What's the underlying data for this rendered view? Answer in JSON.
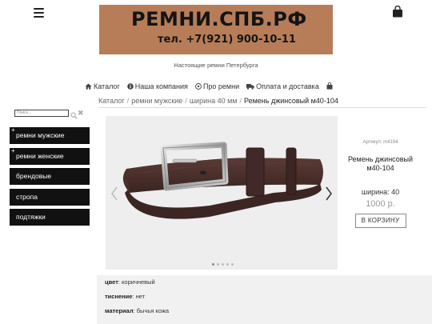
{
  "header": {
    "logo_title": "РЕМНИ.СПБ.РФ",
    "logo_phone": "тел. +7(921) 900-10-11",
    "tagline": "Настоящие ремни Петербурга",
    "icons": {
      "menu": "hamburger-menu-icon",
      "cart": "shopping-bag-icon"
    }
  },
  "nav": {
    "items": [
      {
        "label": "Каталог",
        "icon": "home-icon"
      },
      {
        "label": "Наша компания",
        "icon": "info-icon"
      },
      {
        "label": "Про ремни",
        "icon": "soccer-ball-icon"
      },
      {
        "label": "Оплата и доставка",
        "icon": "truck-icon"
      }
    ],
    "cart_icon": "shopping-bag-icon"
  },
  "search": {
    "placeholder": "Поиск..."
  },
  "sidebar": {
    "items": [
      {
        "label": "ремни мужские",
        "expandable": true
      },
      {
        "label": "ремни женские",
        "expandable": true
      },
      {
        "label": "брендовые",
        "expandable": false
      },
      {
        "label": "стропа",
        "expandable": false
      },
      {
        "label": "подтяжки",
        "expandable": false
      }
    ]
  },
  "breadcrumb": {
    "items": [
      "Каталог",
      "ремни мужские",
      "ширина 40 мм"
    ],
    "current": "Ремень джинсовый м40-104"
  },
  "gallery": {
    "slide_count": 5,
    "active_index": 0
  },
  "product": {
    "sku": "Артикул: m4104",
    "name": "Ремень джинсовый м40-104",
    "width": "ширина: 40",
    "price": "1000 р.",
    "buy_label": "В КОРЗИНУ"
  },
  "properties": [
    {
      "key": "цвет",
      "value": ": коричневый"
    },
    {
      "key": "тиснение",
      "value": ": нет"
    },
    {
      "key": "материал",
      "value": ": бычья кожа"
    }
  ],
  "colors": {
    "logo_bg": "#b77d58",
    "sidebar_bg": "#111111",
    "belt_leather": "#4a2f2b",
    "props_bg": "#f1f1f1"
  }
}
